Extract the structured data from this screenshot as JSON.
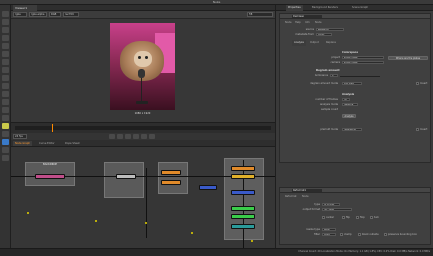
{
  "app": {
    "title": "Nuke"
  },
  "viewer": {
    "tab": "Viewer1",
    "controls": [
      "rgba",
      "rgba.alpha",
      "RGB",
      "rec709"
    ],
    "zoom": "f/8",
    "frame_caption": "1080 x 1920",
    "frame_range_label": "24 fps"
  },
  "node_graph": {
    "tabs": [
      "Node Graph",
      "Curve Editor",
      "Dope Sheet"
    ],
    "backdrops": [
      "BACKDROP",
      "",
      ""
    ]
  },
  "properties": {
    "tabs": [
      "Properties",
      "Background Renders",
      "Scene Graph"
    ],
    "panel1": {
      "name": "DeiClean",
      "subtabs": [
        "Node",
        "Help",
        "Info",
        "Node"
      ],
      "source_label": "source",
      "source_value": "sequence",
      "metadata_label": "metadata from",
      "metadata_value": "COMP",
      "tabs": [
        "Analyze",
        "Output",
        "Replace"
      ],
      "colorspace_hdr": "Colorspace",
      "project_label": "project",
      "project_value": "scene_linear",
      "where_label": "Where are the plates",
      "camera_label": "camera",
      "camera_value": "scene_linear",
      "degrain_hdr": "Degrain amount",
      "luminance_label": "luminance",
      "luminance_value": "0",
      "degrain_label": "degrain amount mode",
      "degrain_value": "Ego data",
      "invert_label": "Invert",
      "analysis_hdr": "Analysis",
      "frames_label": "number of frames",
      "frames_value": "50",
      "mode_label": "analysis mode",
      "mode_value": "distance",
      "sample_label": "sample count",
      "analyze_btn": "Analyze",
      "premult_label": "premult mode",
      "premult_value": "rgba.alpha"
    },
    "panel2": {
      "name": "Reformat1",
      "subtabs": [
        "Reformat",
        "Node"
      ],
      "type_label": "type",
      "type_value": "to format",
      "output_label": "output format",
      "output_value": "HD_1080",
      "flip_labels": [
        "center",
        "flip",
        "flop",
        "turn"
      ],
      "resize_label": "resize type",
      "resize_value": "width",
      "filter_label": "filter",
      "filter_value": "Cubic",
      "clamp_label": "clamp",
      "black_label": "black outside",
      "pbox_label": "preserve bounding box"
    }
  },
  "status": "Channel Count: 20 Localization Mode: On Memory: 1.1 GB (1.8%) CPU: 0.0% Disk: 0.0 MB/s Network: 0.0 MB/s"
}
